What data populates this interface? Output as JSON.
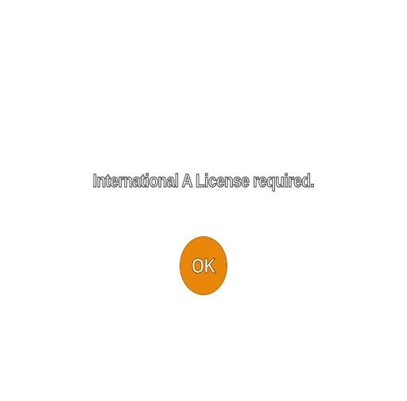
{
  "dialog": {
    "message": "International A License required.",
    "ok_label": "OK"
  },
  "colors": {
    "background": "#ffffff",
    "accent": "#e8870a",
    "message_outline": "#555555"
  }
}
